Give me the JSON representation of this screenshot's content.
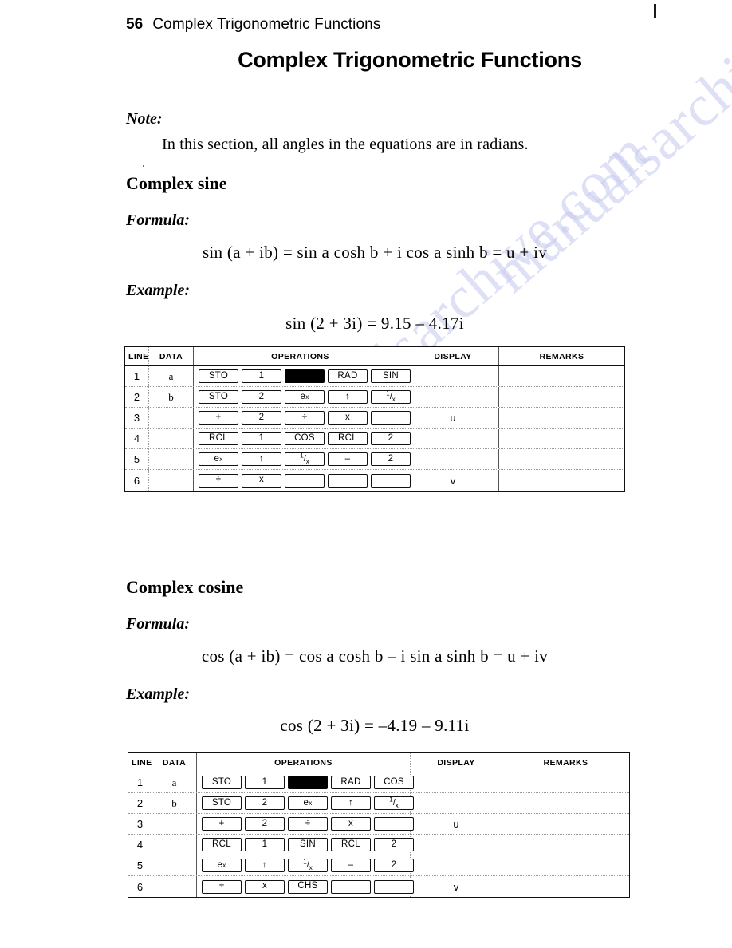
{
  "runhead": {
    "folio": "56",
    "title": "Complex Trigonometric Functions"
  },
  "page_title": "Complex Trigonometric Functions",
  "note": {
    "label": "Note:",
    "text": "In this section, all angles in the equations are in radians."
  },
  "sections": [
    {
      "heading": "Complex sine",
      "formula_label": "Formula:",
      "formula": "sin (a + ib) = sin a cosh b + i cos a sinh b = u + iv",
      "example_label": "Example:",
      "example": "sin (2 + 3i) = 9.15 – 4.17i",
      "table": {
        "headers": [
          "LINE",
          "DATA",
          "OPERATIONS",
          "DISPLAY",
          "REMARKS"
        ],
        "rows": [
          {
            "line": "1",
            "data": "a",
            "keys": [
              "STO",
              "1",
              "■",
              "RAD",
              "SIN"
            ],
            "display": "",
            "remarks": ""
          },
          {
            "line": "2",
            "data": "b",
            "keys": [
              "STO",
              "2",
              "e^x",
              "↑",
              "1/x"
            ],
            "display": "",
            "remarks": ""
          },
          {
            "line": "3",
            "data": "",
            "keys": [
              "+",
              "2",
              "÷",
              "x",
              ""
            ],
            "display": "u",
            "remarks": ""
          },
          {
            "line": "4",
            "data": "",
            "keys": [
              "RCL",
              "1",
              "COS",
              "RCL",
              "2"
            ],
            "display": "",
            "remarks": ""
          },
          {
            "line": "5",
            "data": "",
            "keys": [
              "e^x",
              "↑",
              "1/x",
              "–",
              "2"
            ],
            "display": "",
            "remarks": ""
          },
          {
            "line": "6",
            "data": "",
            "keys": [
              "÷",
              "x",
              "",
              "",
              ""
            ],
            "display": "v",
            "remarks": ""
          }
        ]
      }
    },
    {
      "heading": "Complex cosine",
      "formula_label": "Formula:",
      "formula": "cos (a + ib) = cos a cosh b – i sin a sinh b = u + iv",
      "example_label": "Example:",
      "example": "cos (2 + 3i) = –4.19 – 9.11i",
      "table": {
        "headers": [
          "LINE",
          "DATA",
          "OPERATIONS",
          "DISPLAY",
          "REMARKS"
        ],
        "rows": [
          {
            "line": "1",
            "data": "a",
            "keys": [
              "STO",
              "1",
              "■",
              "RAD",
              "COS"
            ],
            "display": "",
            "remarks": ""
          },
          {
            "line": "2",
            "data": "b",
            "keys": [
              "STO",
              "2",
              "e^x",
              "↑",
              "1/x"
            ],
            "display": "",
            "remarks": ""
          },
          {
            "line": "3",
            "data": "",
            "keys": [
              "+",
              "2",
              "÷",
              "x",
              ""
            ],
            "display": "u",
            "remarks": ""
          },
          {
            "line": "4",
            "data": "",
            "keys": [
              "RCL",
              "1",
              "SIN",
              "RCL",
              "2"
            ],
            "display": "",
            "remarks": ""
          },
          {
            "line": "5",
            "data": "",
            "keys": [
              "e^x",
              "↑",
              "1/x",
              "–",
              "2"
            ],
            "display": "",
            "remarks": ""
          },
          {
            "line": "6",
            "data": "",
            "keys": [
              "÷",
              "x",
              "CHS",
              "",
              ""
            ],
            "display": "v",
            "remarks": ""
          }
        ]
      }
    }
  ],
  "watermark": {
    "text": "manualsarchive.com",
    "color": "#c9cdf0"
  }
}
